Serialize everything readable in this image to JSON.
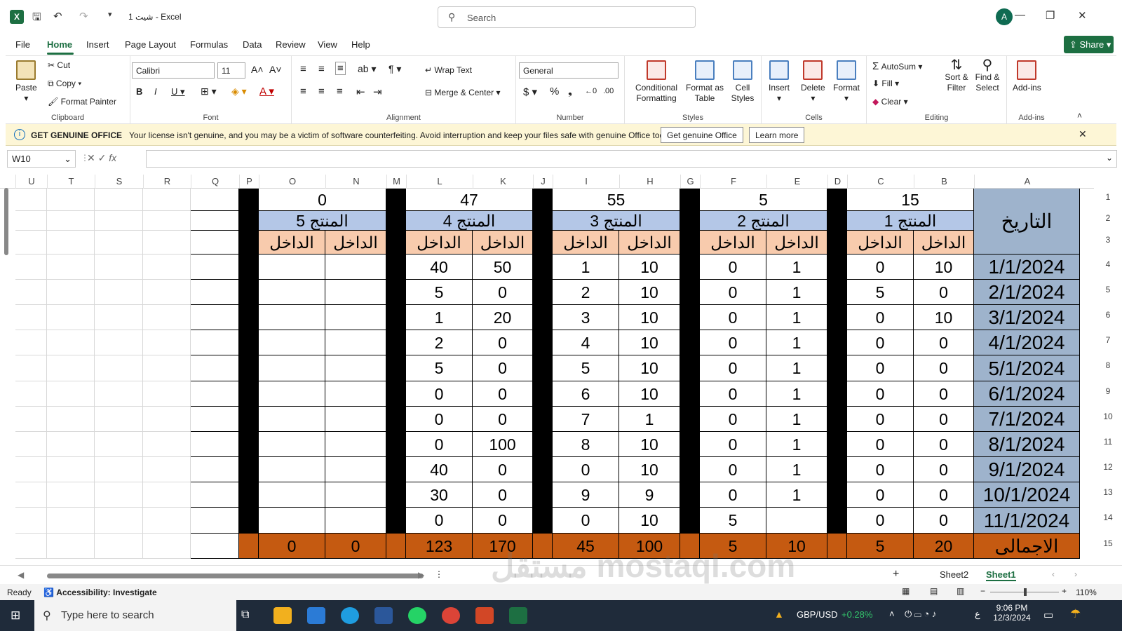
{
  "window": {
    "title": "شيت 1  -  Excel",
    "search_placeholder": "Search",
    "avatar": "A"
  },
  "menu": {
    "tabs": [
      "File",
      "Home",
      "Insert",
      "Page Layout",
      "Formulas",
      "Data",
      "Review",
      "View",
      "Help"
    ],
    "active": "Home",
    "share": "Share"
  },
  "ribbon": {
    "clipboard": {
      "label": "Clipboard",
      "paste": "Paste",
      "cut": "Cut",
      "copy": "Copy",
      "format_painter": "Format Painter"
    },
    "font": {
      "label": "Font",
      "family": "Calibri",
      "size": "11"
    },
    "alignment": {
      "label": "Alignment",
      "wrap": "Wrap Text",
      "merge": "Merge & Center"
    },
    "number": {
      "label": "Number",
      "format": "General"
    },
    "styles": {
      "label": "Styles",
      "cond": "Conditional Formatting",
      "table": "Format as Table",
      "cell": "Cell Styles"
    },
    "cells": {
      "label": "Cells",
      "insert": "Insert",
      "delete": "Delete",
      "format": "Format"
    },
    "editing": {
      "label": "Editing",
      "autosum": "AutoSum",
      "fill": "Fill",
      "clear": "Clear",
      "sort": "Sort & Filter",
      "find": "Find & Select"
    },
    "addins": {
      "label": "Add-ins",
      "addins": "Add-ins"
    }
  },
  "banner": {
    "title": "GET GENUINE OFFICE",
    "text": "Your license isn't genuine, and you may be a victim of software counterfeiting. Avoid interruption and keep your files safe with genuine Office today.",
    "btn1": "Get genuine Office",
    "btn2": "Learn more"
  },
  "formula_bar": {
    "name_box": "W10",
    "fx": "fx",
    "value": ""
  },
  "columns": [
    "U",
    "T",
    "S",
    "R",
    "Q",
    "P",
    "O",
    "N",
    "M",
    "L",
    "K",
    "J",
    "I",
    "H",
    "G",
    "F",
    "E",
    "D",
    "C",
    "B",
    "A"
  ],
  "rows": [
    "1",
    "2",
    "3",
    "4",
    "5",
    "6",
    "7",
    "8",
    "9",
    "10",
    "11",
    "12",
    "13",
    "14",
    "15"
  ],
  "sheet": {
    "totals_top": {
      "p5": "0",
      "p4": "47",
      "p3": "55",
      "p2": "5",
      "p1": "15"
    },
    "products": {
      "p5": "المنتج 5",
      "p4": "المنتج 4",
      "p3": "المنتج 3",
      "p2": "المنتج 2",
      "p1": "المنتج 1"
    },
    "sub": "الداخل",
    "date_header": "التاريخ",
    "dates": [
      "1/1/2024",
      "2/1/2024",
      "3/1/2024",
      "4/1/2024",
      "5/1/2024",
      "6/1/2024",
      "7/1/2024",
      "8/1/2024",
      "9/1/2024",
      "10/1/2024",
      "11/1/2024"
    ],
    "B": [
      "10",
      "0",
      "10",
      "0",
      "0",
      "0",
      "0",
      "0",
      "0",
      "0",
      "0"
    ],
    "C": [
      "0",
      "5",
      "0",
      "0",
      "0",
      "0",
      "0",
      "0",
      "0",
      "0",
      "0"
    ],
    "E": [
      "1",
      "1",
      "1",
      "1",
      "1",
      "1",
      "1",
      "1",
      "1",
      "1",
      ""
    ],
    "F": [
      "0",
      "0",
      "0",
      "0",
      "0",
      "0",
      "0",
      "0",
      "0",
      "0",
      "5"
    ],
    "H": [
      "10",
      "10",
      "10",
      "10",
      "10",
      "10",
      "1",
      "10",
      "10",
      "9",
      "10"
    ],
    "I": [
      "1",
      "2",
      "3",
      "4",
      "5",
      "6",
      "7",
      "8",
      "0",
      "9",
      "0"
    ],
    "K": [
      "50",
      "0",
      "20",
      "0",
      "0",
      "0",
      "0",
      "100",
      "0",
      "0",
      "0"
    ],
    "L": [
      "40",
      "5",
      "1",
      "2",
      "5",
      "0",
      "0",
      "0",
      "40",
      "30",
      "0"
    ],
    "total_label": "الاجمالى",
    "totals": {
      "B": "20",
      "C": "5",
      "E": "10",
      "F": "5",
      "H": "100",
      "I": "45",
      "K": "170",
      "L": "123",
      "N": "0",
      "O": "0"
    }
  },
  "sheets": {
    "tabs": [
      "Sheet2",
      "Sheet1"
    ],
    "active": "Sheet1"
  },
  "status": {
    "ready": "Ready",
    "accessibility": "Accessibility: Investigate",
    "zoom": "110%"
  },
  "taskbar": {
    "search": "Type here to search",
    "ticker": "GBP/USD",
    "change": "+0.28%",
    "time": "9:06 PM",
    "date": "12/3/2024",
    "lang": "ع"
  },
  "watermark": "مستقل mostaql.com",
  "colors": {
    "accent": "#1d6f42",
    "product_header": "#b4c7e7",
    "sub_header": "#f8cbad",
    "date_col": "#9eb3cc",
    "totals": "#c55a11",
    "separator": "#000000"
  }
}
